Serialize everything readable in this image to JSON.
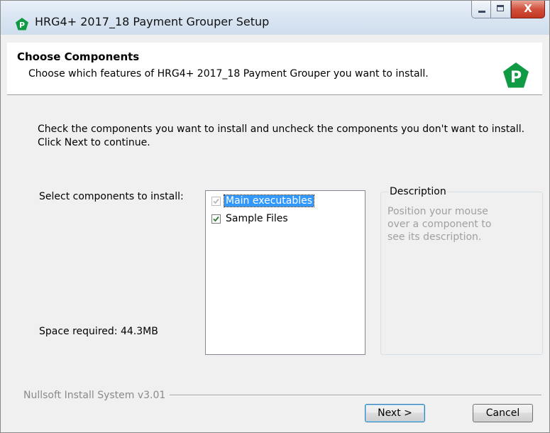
{
  "window": {
    "title": "HRG4+ 2017_18 Payment Grouper Setup",
    "close_glyph": "X"
  },
  "header": {
    "title": "Choose Components",
    "subtitle": "Choose which features of HRG4+ 2017_18 Payment Grouper you want to install.",
    "logo_letter": "P",
    "logo_color": "#119a44"
  },
  "body": {
    "intro": "Check the components you want to install and uncheck the components you don't want to install. Click Next to continue.",
    "select_label": "Select components to install:",
    "space_required": "Space required: 44.3MB"
  },
  "components": [
    {
      "label": "Main executables",
      "checked": true,
      "disabled": true,
      "selected": true
    },
    {
      "label": "Sample Files",
      "checked": true,
      "disabled": false,
      "selected": false
    }
  ],
  "description": {
    "legend": "Description",
    "text": "Position your mouse over a component to see its description."
  },
  "footer": {
    "branding": "Nullsoft Install System v3.01",
    "next_label": "Next >",
    "cancel_label": "Cancel"
  },
  "colors": {
    "accent": "#3399ff",
    "brand": "#119a44"
  }
}
